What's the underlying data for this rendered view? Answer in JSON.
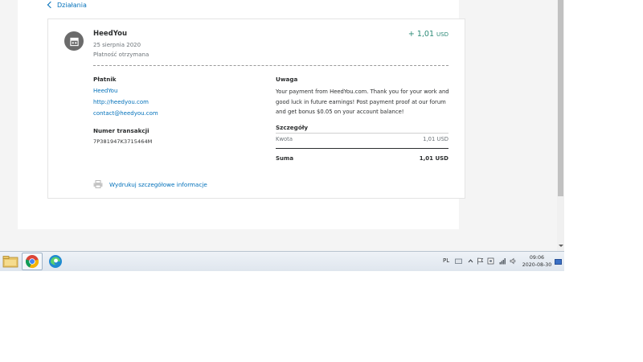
{
  "nav": {
    "back_label": "Działania"
  },
  "transaction": {
    "merchant": "HeedYou",
    "date": "25 sierpnia 2020",
    "status": "Płatność otrzymana",
    "amount": "+ 1,01",
    "currency": "USD"
  },
  "payer": {
    "label": "Płatnik",
    "name": "HeedYou",
    "url": "http://heedyou.com",
    "email": "contact@heedyou.com"
  },
  "transaction_id": {
    "label": "Numer transakcji",
    "value": "7P381947K3715464M"
  },
  "note": {
    "label": "Uwaga",
    "text": "Your payment from HeedYou.com. Thank you for your work and good luck in future earnings! Post payment proof at our forum and get bonus $0.05 on your account balance!"
  },
  "details": {
    "label": "Szczegóły",
    "amount_label": "Kwota",
    "amount_value": "1,01 USD",
    "total_label": "Suma",
    "total_value": "1,01 USD"
  },
  "print_label": "Wydrukuj szczegółowe informacje",
  "taskbar": {
    "language": "PL",
    "time": "09:06",
    "date": "2020-08-30"
  },
  "colors": {
    "link": "#0070ba",
    "amount_positive": "#2c8a77",
    "icon_gray": "#6b6b6b"
  }
}
